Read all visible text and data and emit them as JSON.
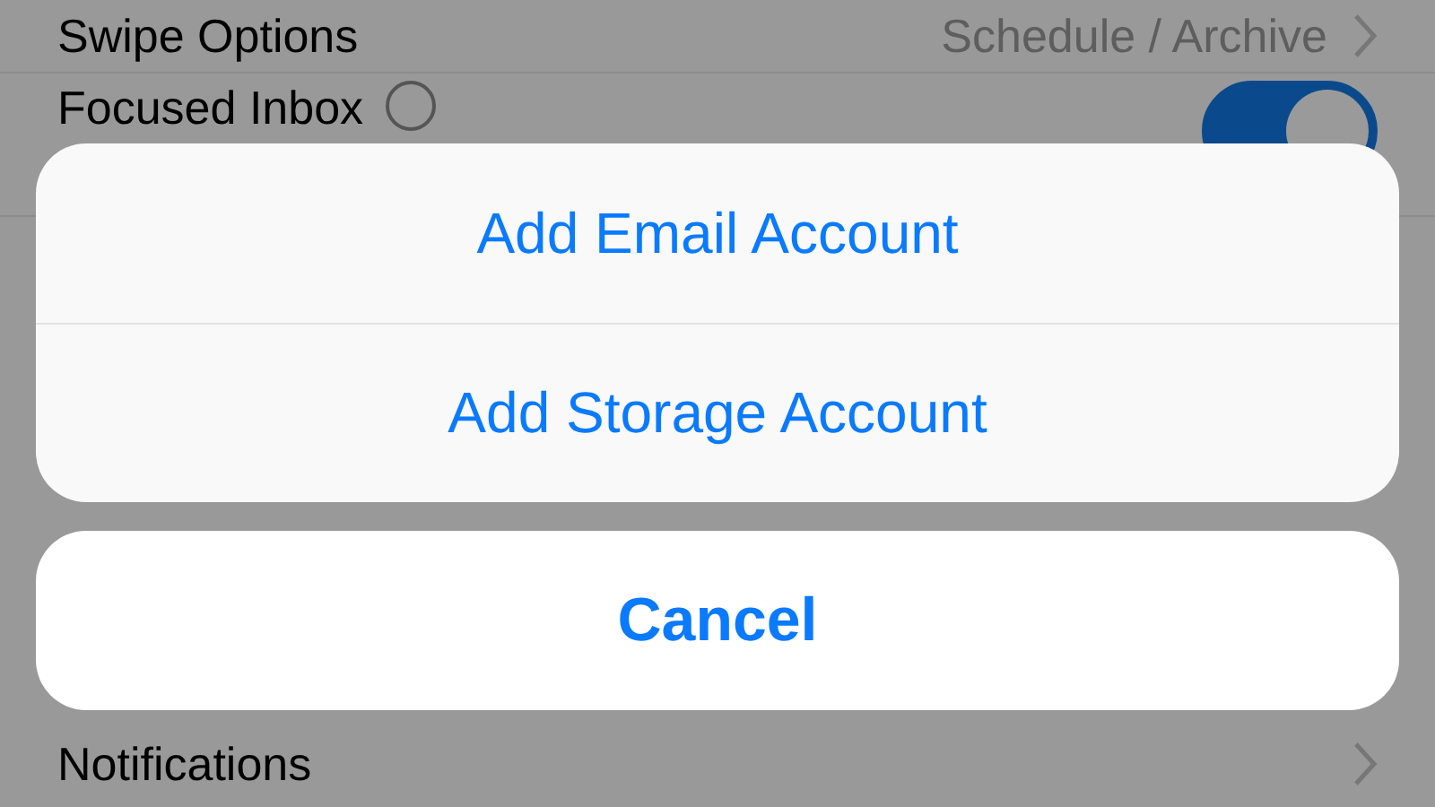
{
  "settings": {
    "rows": [
      {
        "kind": "link",
        "label": "Swipe Options",
        "value": "Schedule / Archive"
      },
      {
        "kind": "toggle",
        "label": "Focused Inbox",
        "on": true
      },
      {
        "kind": "link",
        "label": "Notifications"
      }
    ]
  },
  "action_sheet": {
    "actions": [
      "Add Email Account",
      "Add Storage Account"
    ],
    "cancel": "Cancel"
  }
}
